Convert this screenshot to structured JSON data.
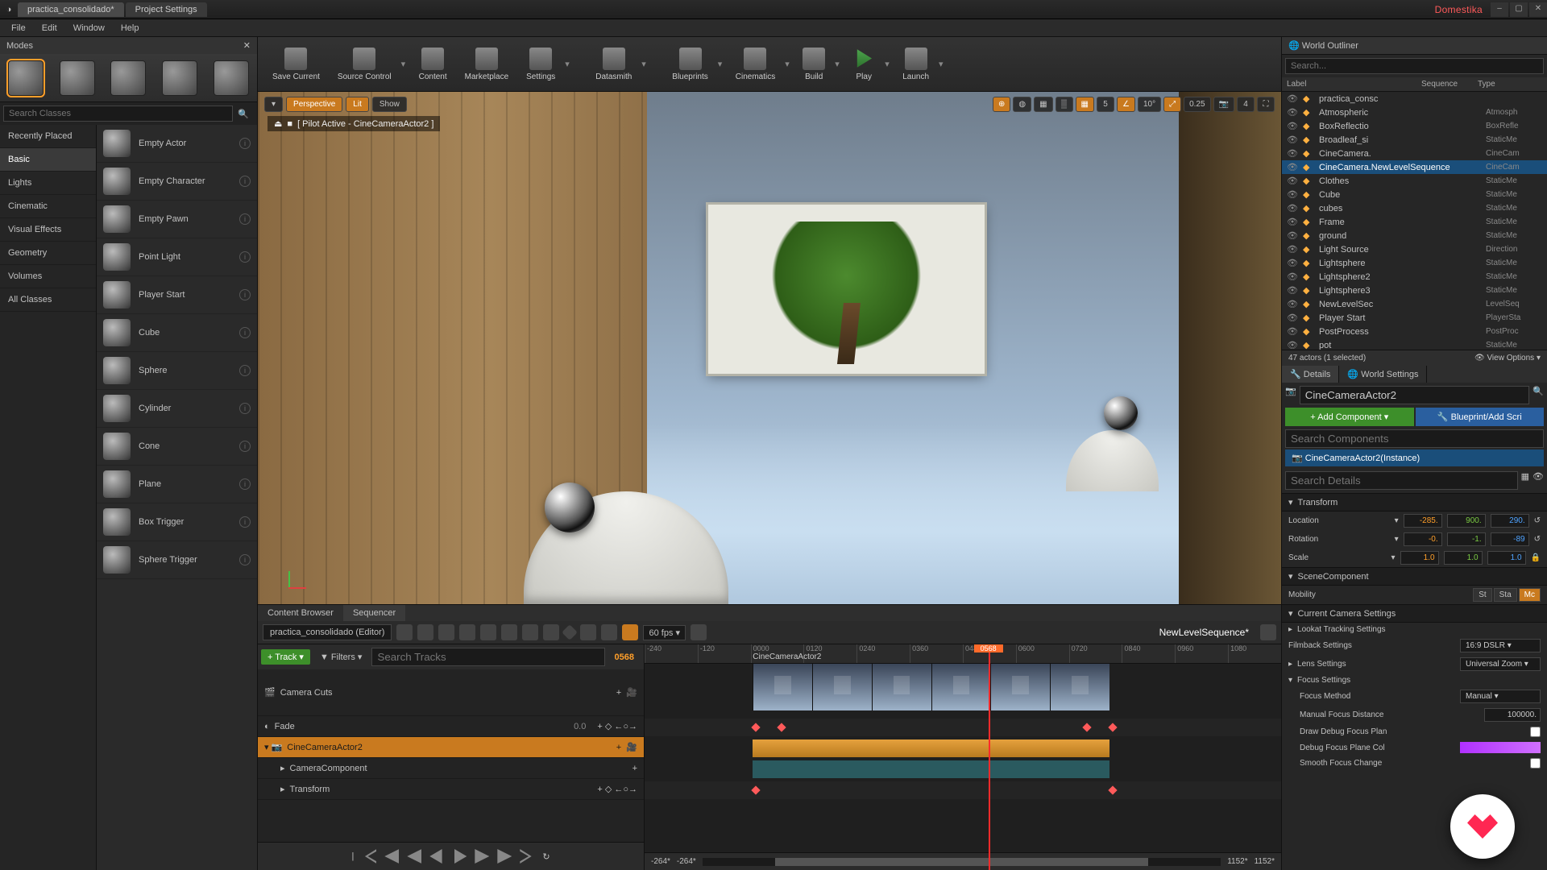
{
  "title": {
    "tab1": "practica_consolidado*",
    "tab2": "Project Settings",
    "brand": "Domestika"
  },
  "menu": {
    "file": "File",
    "edit": "Edit",
    "window": "Window",
    "help": "Help"
  },
  "modes": {
    "header": "Modes",
    "search_ph": "Search Classes",
    "cats": {
      "recent": "Recently Placed",
      "basic": "Basic",
      "lights": "Lights",
      "cinematic": "Cinematic",
      "vfx": "Visual Effects",
      "geometry": "Geometry",
      "volumes": "Volumes",
      "all": "All Classes"
    },
    "actors": {
      "empty_actor": "Empty Actor",
      "empty_character": "Empty Character",
      "empty_pawn": "Empty Pawn",
      "point_light": "Point Light",
      "player_start": "Player Start",
      "cube": "Cube",
      "sphere": "Sphere",
      "cylinder": "Cylinder",
      "cone": "Cone",
      "plane": "Plane",
      "box_trigger": "Box Trigger",
      "sphere_trigger": "Sphere Trigger"
    }
  },
  "toolbar": {
    "save": "Save Current",
    "source": "Source Control",
    "content": "Content",
    "market": "Marketplace",
    "settings": "Settings",
    "datasmith": "Datasmith",
    "blueprints": "Blueprints",
    "cinematics": "Cinematics",
    "build": "Build",
    "play": "Play",
    "launch": "Launch"
  },
  "viewport": {
    "perspective": "Perspective",
    "lit": "Lit",
    "show": "Show",
    "pilot": "[ Pilot Active - CineCameraActor2 ]",
    "snap1": "5",
    "angle": "10°",
    "scale": "0.25",
    "cam": "4"
  },
  "outliner": {
    "header": "World Outliner",
    "search_ph": "Search...",
    "col_label": "Label",
    "col_seq": "Sequence",
    "col_type": "Type",
    "footer": "47 actors (1 selected)",
    "view_options": "View Options",
    "rows": [
      {
        "n": "practica_consc",
        "t": ""
      },
      {
        "n": "Atmospheric",
        "t": "Atmosph"
      },
      {
        "n": "BoxReflectio",
        "t": "BoxRefle"
      },
      {
        "n": "Broadleaf_si",
        "t": "StaticMe"
      },
      {
        "n": "CineCamera.",
        "t": "CineCam"
      },
      {
        "n": "CineCamera.NewLevelSequence",
        "t": "CineCam",
        "sel": true
      },
      {
        "n": "Clothes",
        "t": "StaticMe"
      },
      {
        "n": "Cube",
        "t": "StaticMe"
      },
      {
        "n": "cubes",
        "t": "StaticMe"
      },
      {
        "n": "Frame",
        "t": "StaticMe"
      },
      {
        "n": "ground",
        "t": "StaticMe"
      },
      {
        "n": "Light Source",
        "t": "Direction"
      },
      {
        "n": "Lightsphere",
        "t": "StaticMe"
      },
      {
        "n": "Lightsphere2",
        "t": "StaticMe"
      },
      {
        "n": "Lightsphere3",
        "t": "StaticMe"
      },
      {
        "n": "NewLevelSec",
        "t": "LevelSeq"
      },
      {
        "n": "Player Start",
        "t": "PlayerSta"
      },
      {
        "n": "PostProcess",
        "t": "PostProc"
      },
      {
        "n": "pot",
        "t": "StaticMe"
      }
    ]
  },
  "details": {
    "tab_details": "Details",
    "tab_world": "World Settings",
    "actor_name": "CineCameraActor2",
    "add_comp": "+ Add Component",
    "blueprint": "Blueprint/Add Scri",
    "search_comp_ph": "Search Components",
    "instance": "CineCameraActor2(Instance)",
    "search_det_ph": "Search Details",
    "transform": "Transform",
    "location": "Location",
    "rotation": "Rotation",
    "scale": "Scale",
    "loc": {
      "x": "-285.",
      "y": "900.",
      "z": "290."
    },
    "rot": {
      "x": "-0.",
      "y": "-1.",
      "z": "-89"
    },
    "scl": {
      "x": "1.0",
      "y": "1.0",
      "z": "1.0"
    },
    "scene_comp": "SceneComponent",
    "mobility": "Mobility",
    "mob_static": "St",
    "mob_station": "Sta",
    "mob_move": "Mc",
    "ccs": "Current Camera Settings",
    "lookat": "Lookat Tracking Settings",
    "filmback": "Filmback Settings",
    "filmback_v": "16:9 DSLR",
    "lens": "Lens Settings",
    "lens_v": "Universal Zoom",
    "focus": "Focus Settings",
    "focus_method": "Focus Method",
    "focus_method_v": "Manual",
    "manual_focus": "Manual Focus Distance",
    "manual_focus_v": "100000.",
    "draw_debug": "Draw Debug Focus Plan",
    "debug_color": "Debug Focus Plane Col",
    "smooth": "Smooth Focus Change"
  },
  "bottom": {
    "tab_content": "Content Browser",
    "tab_seq": "Sequencer",
    "path": "practica_consolidado (Editor)",
    "fps": "60 fps",
    "seq_name": "NewLevelSequence*",
    "track_btn": "+ Track",
    "filters": "Filters",
    "search_ph": "Search Tracks",
    "cur_frame": "0568",
    "playhead_frame": "0568",
    "ticks": [
      "-240",
      "-120",
      "0000",
      "0120",
      "0240",
      "0360",
      "0480",
      "0600",
      "0720",
      "0840",
      "0960",
      "1080"
    ],
    "camera_cuts": "Camera Cuts",
    "cam_clip": "CineCameraActor2",
    "fade": "Fade",
    "fade_v": "0.0",
    "cinecam": "CineCameraActor2",
    "camera_comp": "CameraComponent",
    "transform_trk": "Transform",
    "range_l": "-264*",
    "range_l2": "-264*",
    "range_r": "1152*",
    "range_r2": "1152*"
  }
}
